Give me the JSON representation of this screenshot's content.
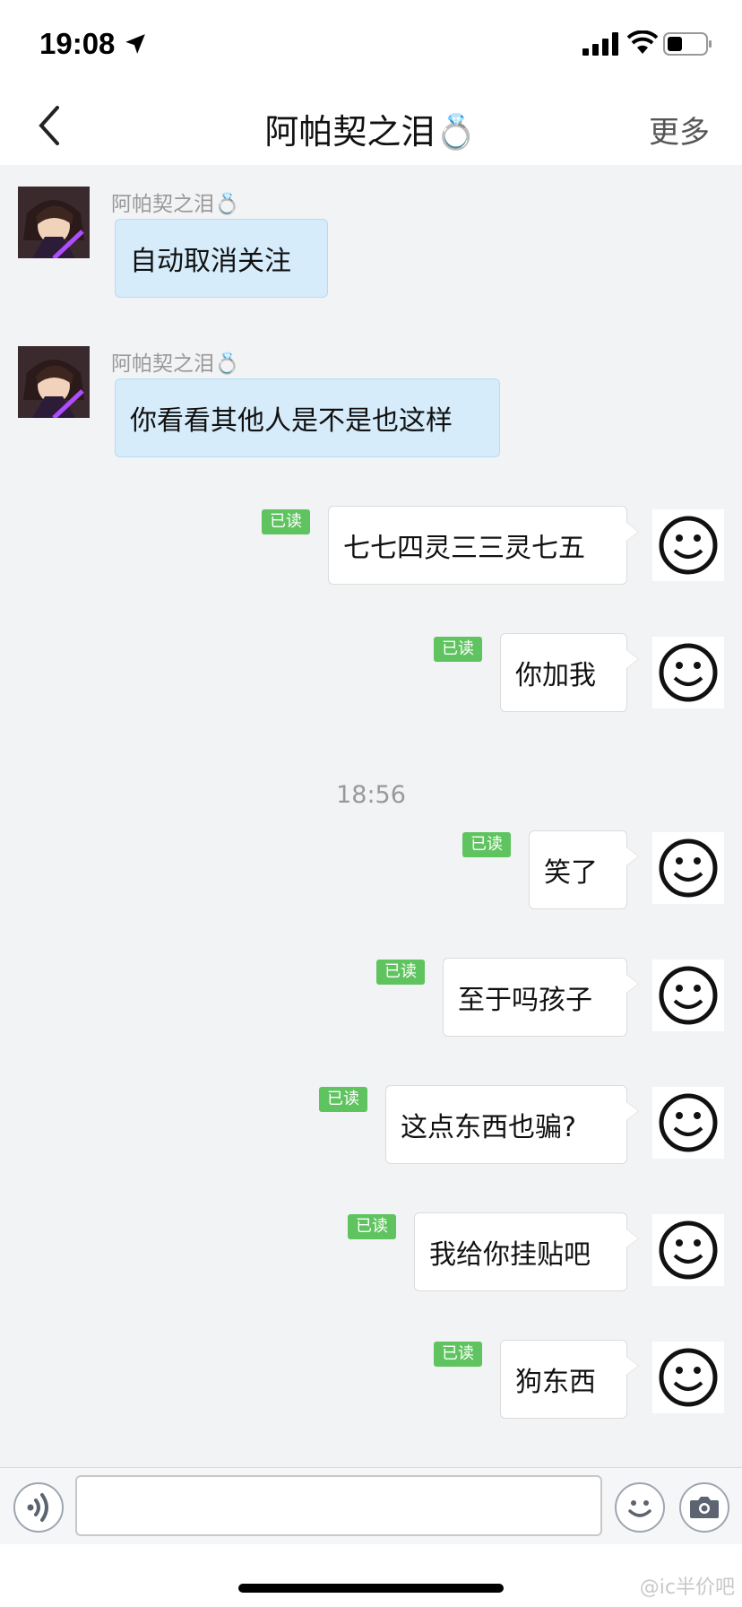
{
  "status_bar": {
    "time": "19:08"
  },
  "nav": {
    "title": "阿帕契之泪💍",
    "more_label": "更多"
  },
  "messages_in": [
    {
      "sender": "阿帕契之泪💍",
      "text": "自动取消关注"
    },
    {
      "sender": "阿帕契之泪💍",
      "text": "你看看其他人是不是也这样"
    }
  ],
  "messages_out": [
    {
      "text": "七七四灵三三灵七五",
      "status": "已读"
    },
    {
      "text": "你加我",
      "status": "已读"
    },
    {
      "text": "笑了",
      "status": "已读"
    },
    {
      "text": "至于吗孩子",
      "status": "已读"
    },
    {
      "text": "这点东西也骗?",
      "status": "已读"
    },
    {
      "text": "我给你挂贴吧",
      "status": "已读"
    },
    {
      "text": "狗东西",
      "status": "已读"
    }
  ],
  "timestamp": "18:56",
  "input": {
    "value": ""
  },
  "watermark": "@ic半价吧",
  "colors": {
    "read_badge": "#5fc45f",
    "bubble_in": "#d6ecfb",
    "background": "#f2f3f5"
  }
}
